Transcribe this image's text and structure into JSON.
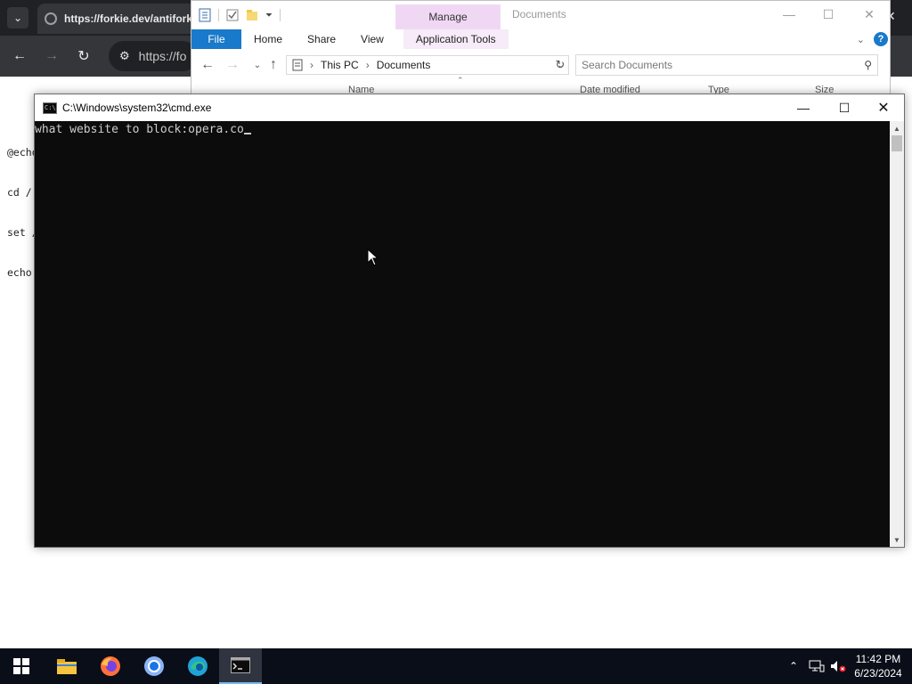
{
  "browser": {
    "tab_title": "https://forkie.dev/antifork",
    "url": "https://fo",
    "page_lines": [
      "@echo",
      "cd /",
      "set /",
      "echo"
    ]
  },
  "explorer": {
    "title": "Documents",
    "manage_label": "Manage",
    "ribbon_tabs": [
      "File",
      "Home",
      "Share",
      "View",
      "Application Tools"
    ],
    "path": [
      "This PC",
      "Documents"
    ],
    "search_placeholder": "Search Documents",
    "columns": [
      "Name",
      "Date modified",
      "Type",
      "Size"
    ]
  },
  "cmd": {
    "title": "C:\\Windows\\system32\\cmd.exe",
    "prompt_line": "what website to block:opera.co"
  },
  "taskbar": {
    "apps": [
      "windows-start",
      "file-explorer",
      "firefox",
      "chrome",
      "edge",
      "command-prompt"
    ],
    "time": "11:42 PM",
    "date": "6/23/2024"
  },
  "colors": {
    "console_bg": "#0c0c0c",
    "console_text": "#cccccc",
    "taskbar_bg": "#0a0e18",
    "file_tab": "#1979ca",
    "manage_tab": "#f0d8f4"
  }
}
